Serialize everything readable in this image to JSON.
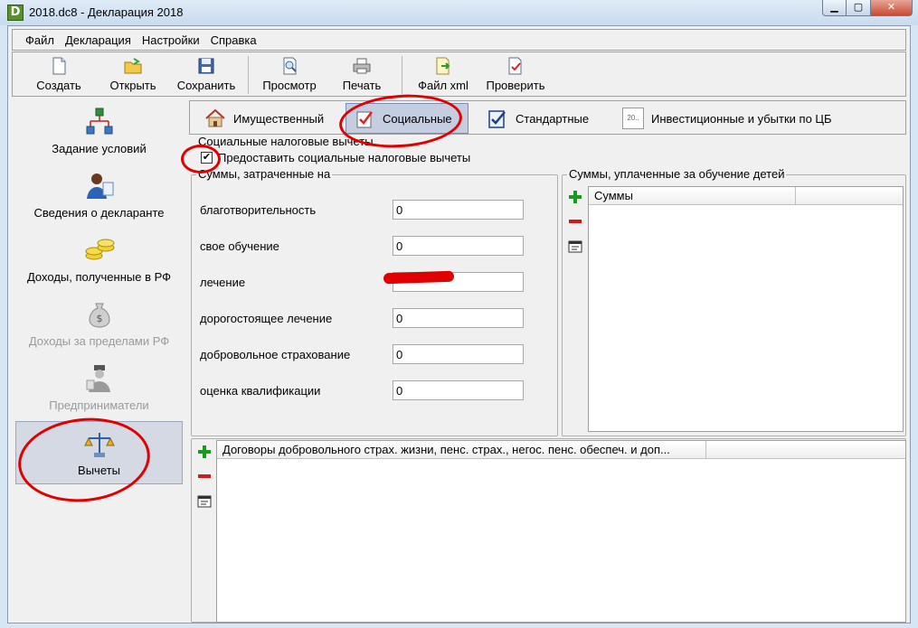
{
  "window": {
    "title": "2018.dc8 - Декларация 2018",
    "app_icon_letter": "D",
    "minimize": "▁",
    "maximize": "▢",
    "close": "✕"
  },
  "menu": [
    "Файл",
    "Декларация",
    "Настройки",
    "Справка"
  ],
  "toolbar": {
    "create": "Создать",
    "open": "Открыть",
    "save": "Сохранить",
    "preview": "Просмотр",
    "print": "Печать",
    "xml": "Файл xml",
    "check": "Проверить"
  },
  "nav": {
    "conditions": "Задание условий",
    "declarant": "Сведения о декларанте",
    "income_rf": "Доходы, полученные в РФ",
    "income_abroad": "Доходы за пределами РФ",
    "entrepreneurs": "Предприниматели",
    "deductions": "Вычеты"
  },
  "tabs": {
    "property": "Имущественный",
    "social": "Социальные",
    "standard": "Стандартные",
    "investment": "Инвестиционные и убытки по ЦБ",
    "investment_icon_text": "20.."
  },
  "social": {
    "group_title": "Социальные налоговые вычеты",
    "provide_checkbox_label": "Предоставить социальные налоговые вычеты",
    "provide_checked": "✔",
    "spent_group_title": "Суммы, затраченные на",
    "fields": [
      {
        "label": "благотворительность",
        "value": "0"
      },
      {
        "label": "свое обучение",
        "value": "0"
      },
      {
        "label": "лечение",
        "value": ""
      },
      {
        "label": "дорогостоящее лечение",
        "value": "0"
      },
      {
        "label": "добровольное страхование",
        "value": "0"
      },
      {
        "label": "оценка квалификации",
        "value": "0"
      }
    ],
    "children_group_title": "Суммы, уплаченные за обучение детей",
    "children_grid_header": "Суммы",
    "contracts_grid_header": "Договоры добровольного страх. жизни, пенс. страх., негос. пенс. обеспеч. и доп..."
  },
  "colors": {
    "annotation_red": "#e00000",
    "add_green": "#1a9a1a",
    "remove_red": "#cc1c1c"
  }
}
